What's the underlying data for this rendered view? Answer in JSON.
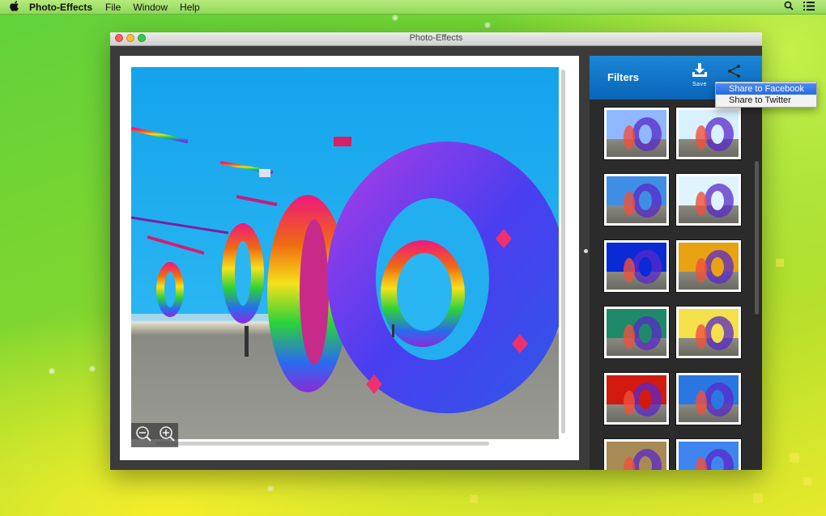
{
  "menubar": {
    "app_name": "Photo-Effects",
    "items": [
      "File",
      "Window",
      "Help"
    ],
    "icons": [
      "apple-icon",
      "spotlight-search-icon",
      "list-icon"
    ]
  },
  "window": {
    "title": "Photo-Effects",
    "traffic_lights": [
      "close",
      "minimize",
      "zoom"
    ]
  },
  "canvas": {
    "zoom_buttons": [
      "zoom-out-icon",
      "zoom-in-icon"
    ]
  },
  "filters_panel": {
    "title": "Filters",
    "save_label": "Save",
    "share_icon": "share-icon",
    "thumbnail_tints": [
      "#8fb8ff",
      "#d9f0ff",
      "#3f8ee6",
      "#e0f4ff",
      "#0a2ad6",
      "#e8a313",
      "#1e8a6a",
      "#f3e04a",
      "#d21a10",
      "#2b77e2",
      "#a88a55",
      "#3f85f0"
    ]
  },
  "share_menu": {
    "items": [
      "Share to Facebook",
      "Share to Twitter"
    ],
    "highlighted": "Share to Facebook"
  },
  "colors": {
    "accent_blue": "#0a64b8",
    "menu_highlight": "#3a7ae8"
  }
}
